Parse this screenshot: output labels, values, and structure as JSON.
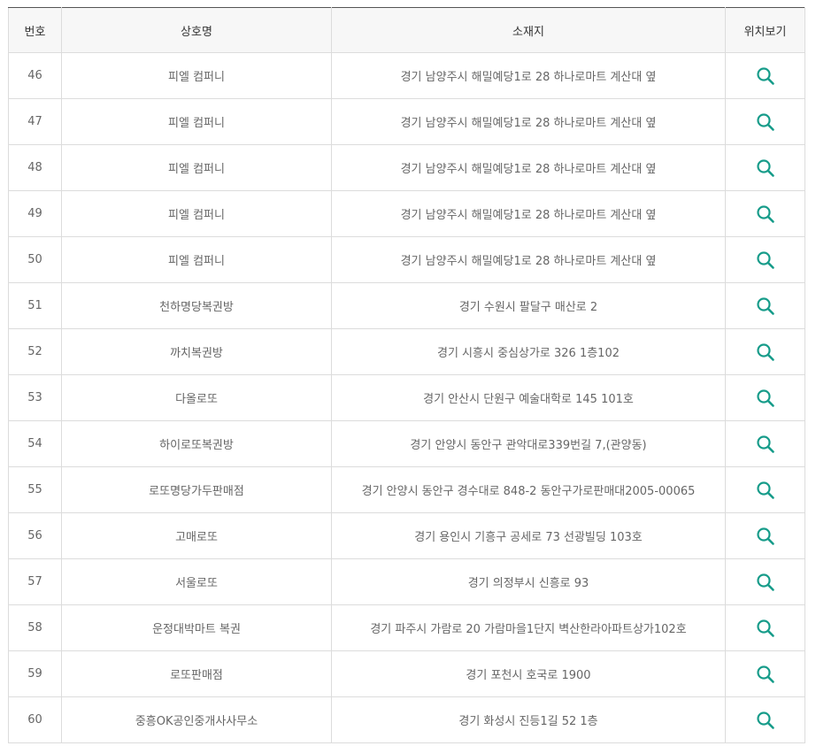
{
  "headers": {
    "no": "번호",
    "name": "상호명",
    "address": "소재지",
    "location": "위치보기"
  },
  "icon_color": "#179c8a",
  "rows": [
    {
      "no": "46",
      "name": "피엘 컴퍼니",
      "address": "경기 남양주시 해밀예당1로 28 하나로마트 계산대 옆"
    },
    {
      "no": "47",
      "name": "피엘 컴퍼니",
      "address": "경기 남양주시 해밀예당1로 28 하나로마트 계산대 옆"
    },
    {
      "no": "48",
      "name": "피엘 컴퍼니",
      "address": "경기 남양주시 해밀예당1로 28 하나로마트 계산대 옆"
    },
    {
      "no": "49",
      "name": "피엘 컴퍼니",
      "address": "경기 남양주시 해밀예당1로 28 하나로마트 계산대 옆"
    },
    {
      "no": "50",
      "name": "피엘 컴퍼니",
      "address": "경기 남양주시 해밀예당1로 28 하나로마트 계산대 옆"
    },
    {
      "no": "51",
      "name": "천하명당복권방",
      "address": "경기 수원시 팔달구 매산로 2"
    },
    {
      "no": "52",
      "name": "까치복권방",
      "address": "경기 시흥시 중심상가로 326 1층102"
    },
    {
      "no": "53",
      "name": "다올로또",
      "address": "경기 안산시 단원구 예술대학로 145 101호"
    },
    {
      "no": "54",
      "name": "하이로또복권방",
      "address": "경기 안양시 동안구 관악대로339번길 7,(관양동)"
    },
    {
      "no": "55",
      "name": "로또명당가두판매점",
      "address": "경기 안양시 동안구 경수대로 848-2 동안구가로판매대2005-00065"
    },
    {
      "no": "56",
      "name": "고매로또",
      "address": "경기 용인시 기흥구 공세로 73 선광빌딩 103호"
    },
    {
      "no": "57",
      "name": "서울로또",
      "address": "경기 의정부시 신흥로 93"
    },
    {
      "no": "58",
      "name": "운정대박마트 복권",
      "address": "경기 파주시 가람로 20 가람마을1단지 벽산한라아파트상가102호"
    },
    {
      "no": "59",
      "name": "로또판매점",
      "address": "경기 포천시 호국로 1900"
    },
    {
      "no": "60",
      "name": "중흥OK공인중개사사무소",
      "address": "경기 화성시 진등1길 52 1층"
    }
  ]
}
